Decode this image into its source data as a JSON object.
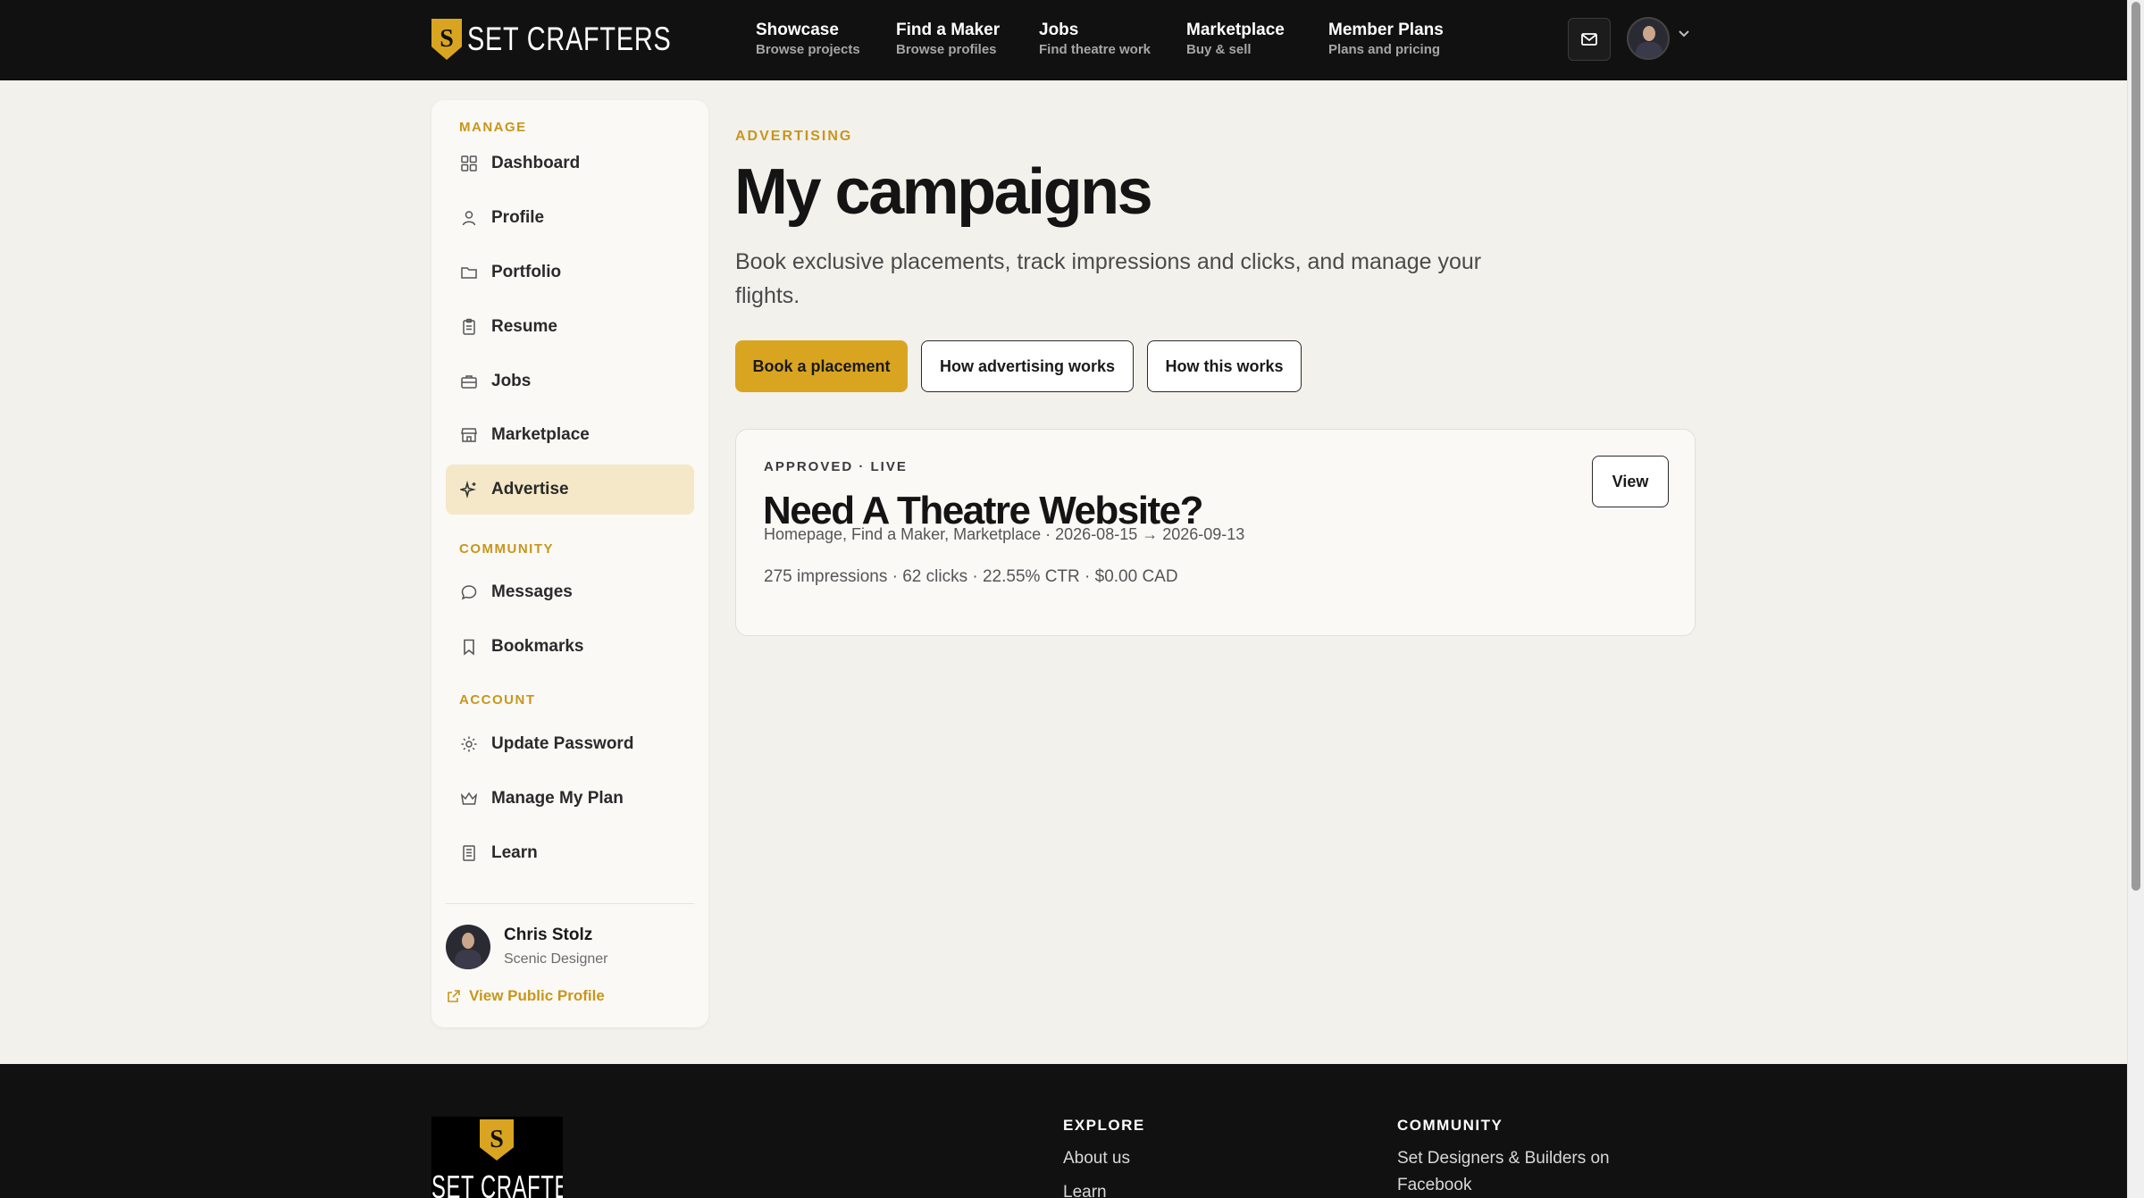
{
  "header": {
    "logo_text": "SET CRAFTERS",
    "logo_mark": "S",
    "nav": [
      {
        "title": "Showcase",
        "subtitle": "Browse projects"
      },
      {
        "title": "Find a Maker",
        "subtitle": "Browse profiles"
      },
      {
        "title": "Jobs",
        "subtitle": "Find theatre work"
      },
      {
        "title": "Marketplace",
        "subtitle": "Buy & sell"
      },
      {
        "title": "Member Plans",
        "subtitle": "Plans and pricing"
      }
    ],
    "icons": {
      "mail": "mail-icon",
      "avatar": "user-avatar",
      "menu": "chevron-down-icon"
    }
  },
  "sidebar": {
    "sections": {
      "manage": "MANAGE",
      "community": "COMMUNITY",
      "account": "ACCOUNT"
    },
    "items": [
      {
        "label": "Dashboard",
        "icon": "grid-icon"
      },
      {
        "label": "Profile",
        "icon": "user-icon"
      },
      {
        "label": "Portfolio",
        "icon": "folder-icon"
      },
      {
        "label": "Resume",
        "icon": "clipboard-icon"
      },
      {
        "label": "Jobs",
        "icon": "briefcase-icon"
      },
      {
        "label": "Marketplace",
        "icon": "store-icon"
      },
      {
        "label": "Advertise",
        "icon": "sparkles-icon",
        "active": true
      },
      {
        "label": "Messages",
        "icon": "chat-icon"
      },
      {
        "label": "Bookmarks",
        "icon": "bookmark-icon"
      },
      {
        "label": "Update Password",
        "icon": "settings-icon"
      },
      {
        "label": "Manage My Plan",
        "icon": "crown-icon"
      },
      {
        "label": "Learn",
        "icon": "book-icon"
      }
    ],
    "user": {
      "name": "Chris Stolz",
      "role": "Scenic Designer",
      "public_link": "View Public Profile"
    }
  },
  "main": {
    "eyebrow": "ADVERTISING",
    "title": "My campaigns",
    "description": "Book exclusive placements, track impressions and clicks, and manage your flights.",
    "buttons": {
      "book": "Book a placement",
      "how_ads": "How advertising works",
      "how_this": "How this works"
    },
    "campaigns": [
      {
        "status": "APPROVED · LIVE",
        "title": "Need A Theatre Website?",
        "meta": "Homepage, Find a Maker, Marketplace · 2026-08-15 → 2026-09-13",
        "stats": "275 impressions · 62 clicks · 22.55% CTR · $0.00 CAD",
        "view_label": "View"
      }
    ]
  },
  "footer": {
    "logo_text": "SET CRAFTERS",
    "logo_mark": "S",
    "explore": {
      "heading": "EXPLORE",
      "links": [
        "About us",
        "Learn"
      ]
    },
    "community": {
      "heading": "COMMUNITY",
      "links": [
        "Set Designers & Builders on Facebook"
      ]
    }
  },
  "colors": {
    "accent": "#d9a521",
    "accent_text": "#c8961a",
    "header_bg": "#111111",
    "page_bg": "#f3f1ec",
    "active_item_bg": "#f5e8c8"
  }
}
